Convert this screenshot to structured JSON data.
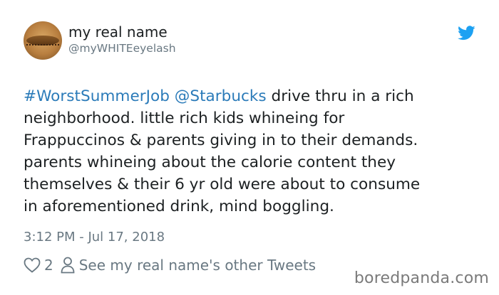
{
  "author": {
    "display_name": "my real name",
    "handle": "@myWHITEeyelash",
    "avatar_icon": "eyelash-avatar"
  },
  "brand_icon": "twitter-bird-icon",
  "colors": {
    "link": "#2b7bb9",
    "text": "#1c2022",
    "muted": "#697882",
    "twitter_blue": "#1da1f2"
  },
  "tweet": {
    "hashtag": "#WorstSummerJob",
    "mention": "@Starbucks",
    "line1_rest": " drive thru in a rich",
    "line2": "neighborhood. little rich kids whineing for",
    "line3": "Frappuccinos & parents giving in to their demands.",
    "line4": "parents whineing about the calorie content they",
    "line5": "themselves & their 6 yr old were about to consume",
    "line6": "in aforementioned drink, mind boggling."
  },
  "timestamp": "3:12 PM - Jul 17, 2018",
  "actions": {
    "like_count": "2",
    "other_tweets_label": "See my real name's other Tweets"
  },
  "watermark": "boredpanda.com"
}
